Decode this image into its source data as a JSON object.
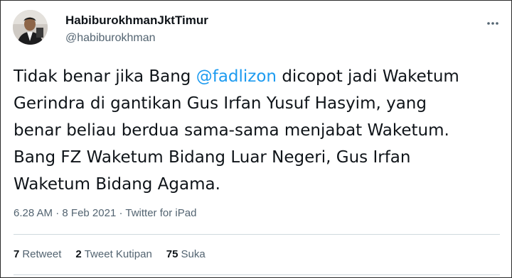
{
  "author": {
    "display_name": "HabiburokhmanJktTimur",
    "handle": "@habiburokhman",
    "avatar_icon": "profile-photo"
  },
  "tweet": {
    "lines": [
      {
        "before": "Tidak benar jika Bang ",
        "mention": "@fadlizon",
        "after": " dicopot jadi Waketum"
      },
      {
        "text": "Gerindra di gantikan Gus Irfan Yusuf Hasyim, yang"
      },
      {
        "text": "benar beliau berdua sama-sama menjabat Waketum."
      },
      {
        "text": "Bang FZ Waketum Bidang Luar Negeri, Gus Irfan"
      },
      {
        "text": "Waketum Bidang Agama."
      }
    ]
  },
  "meta": {
    "time": "6.28 AM",
    "separator": "·",
    "date": "8 Feb 2021",
    "source": "Twitter for iPad"
  },
  "stats": {
    "retweets_count": "7",
    "retweets_label": "Retweet",
    "quotes_count": "2",
    "quotes_label": "Tweet Kutipan",
    "likes_count": "75",
    "likes_label": "Suka"
  },
  "colors": {
    "accent": "#1d9bf0",
    "text": "#0f1419",
    "secondary": "#536471",
    "divider": "#cfd9de"
  },
  "icons": {
    "more": "more-options-icon"
  }
}
